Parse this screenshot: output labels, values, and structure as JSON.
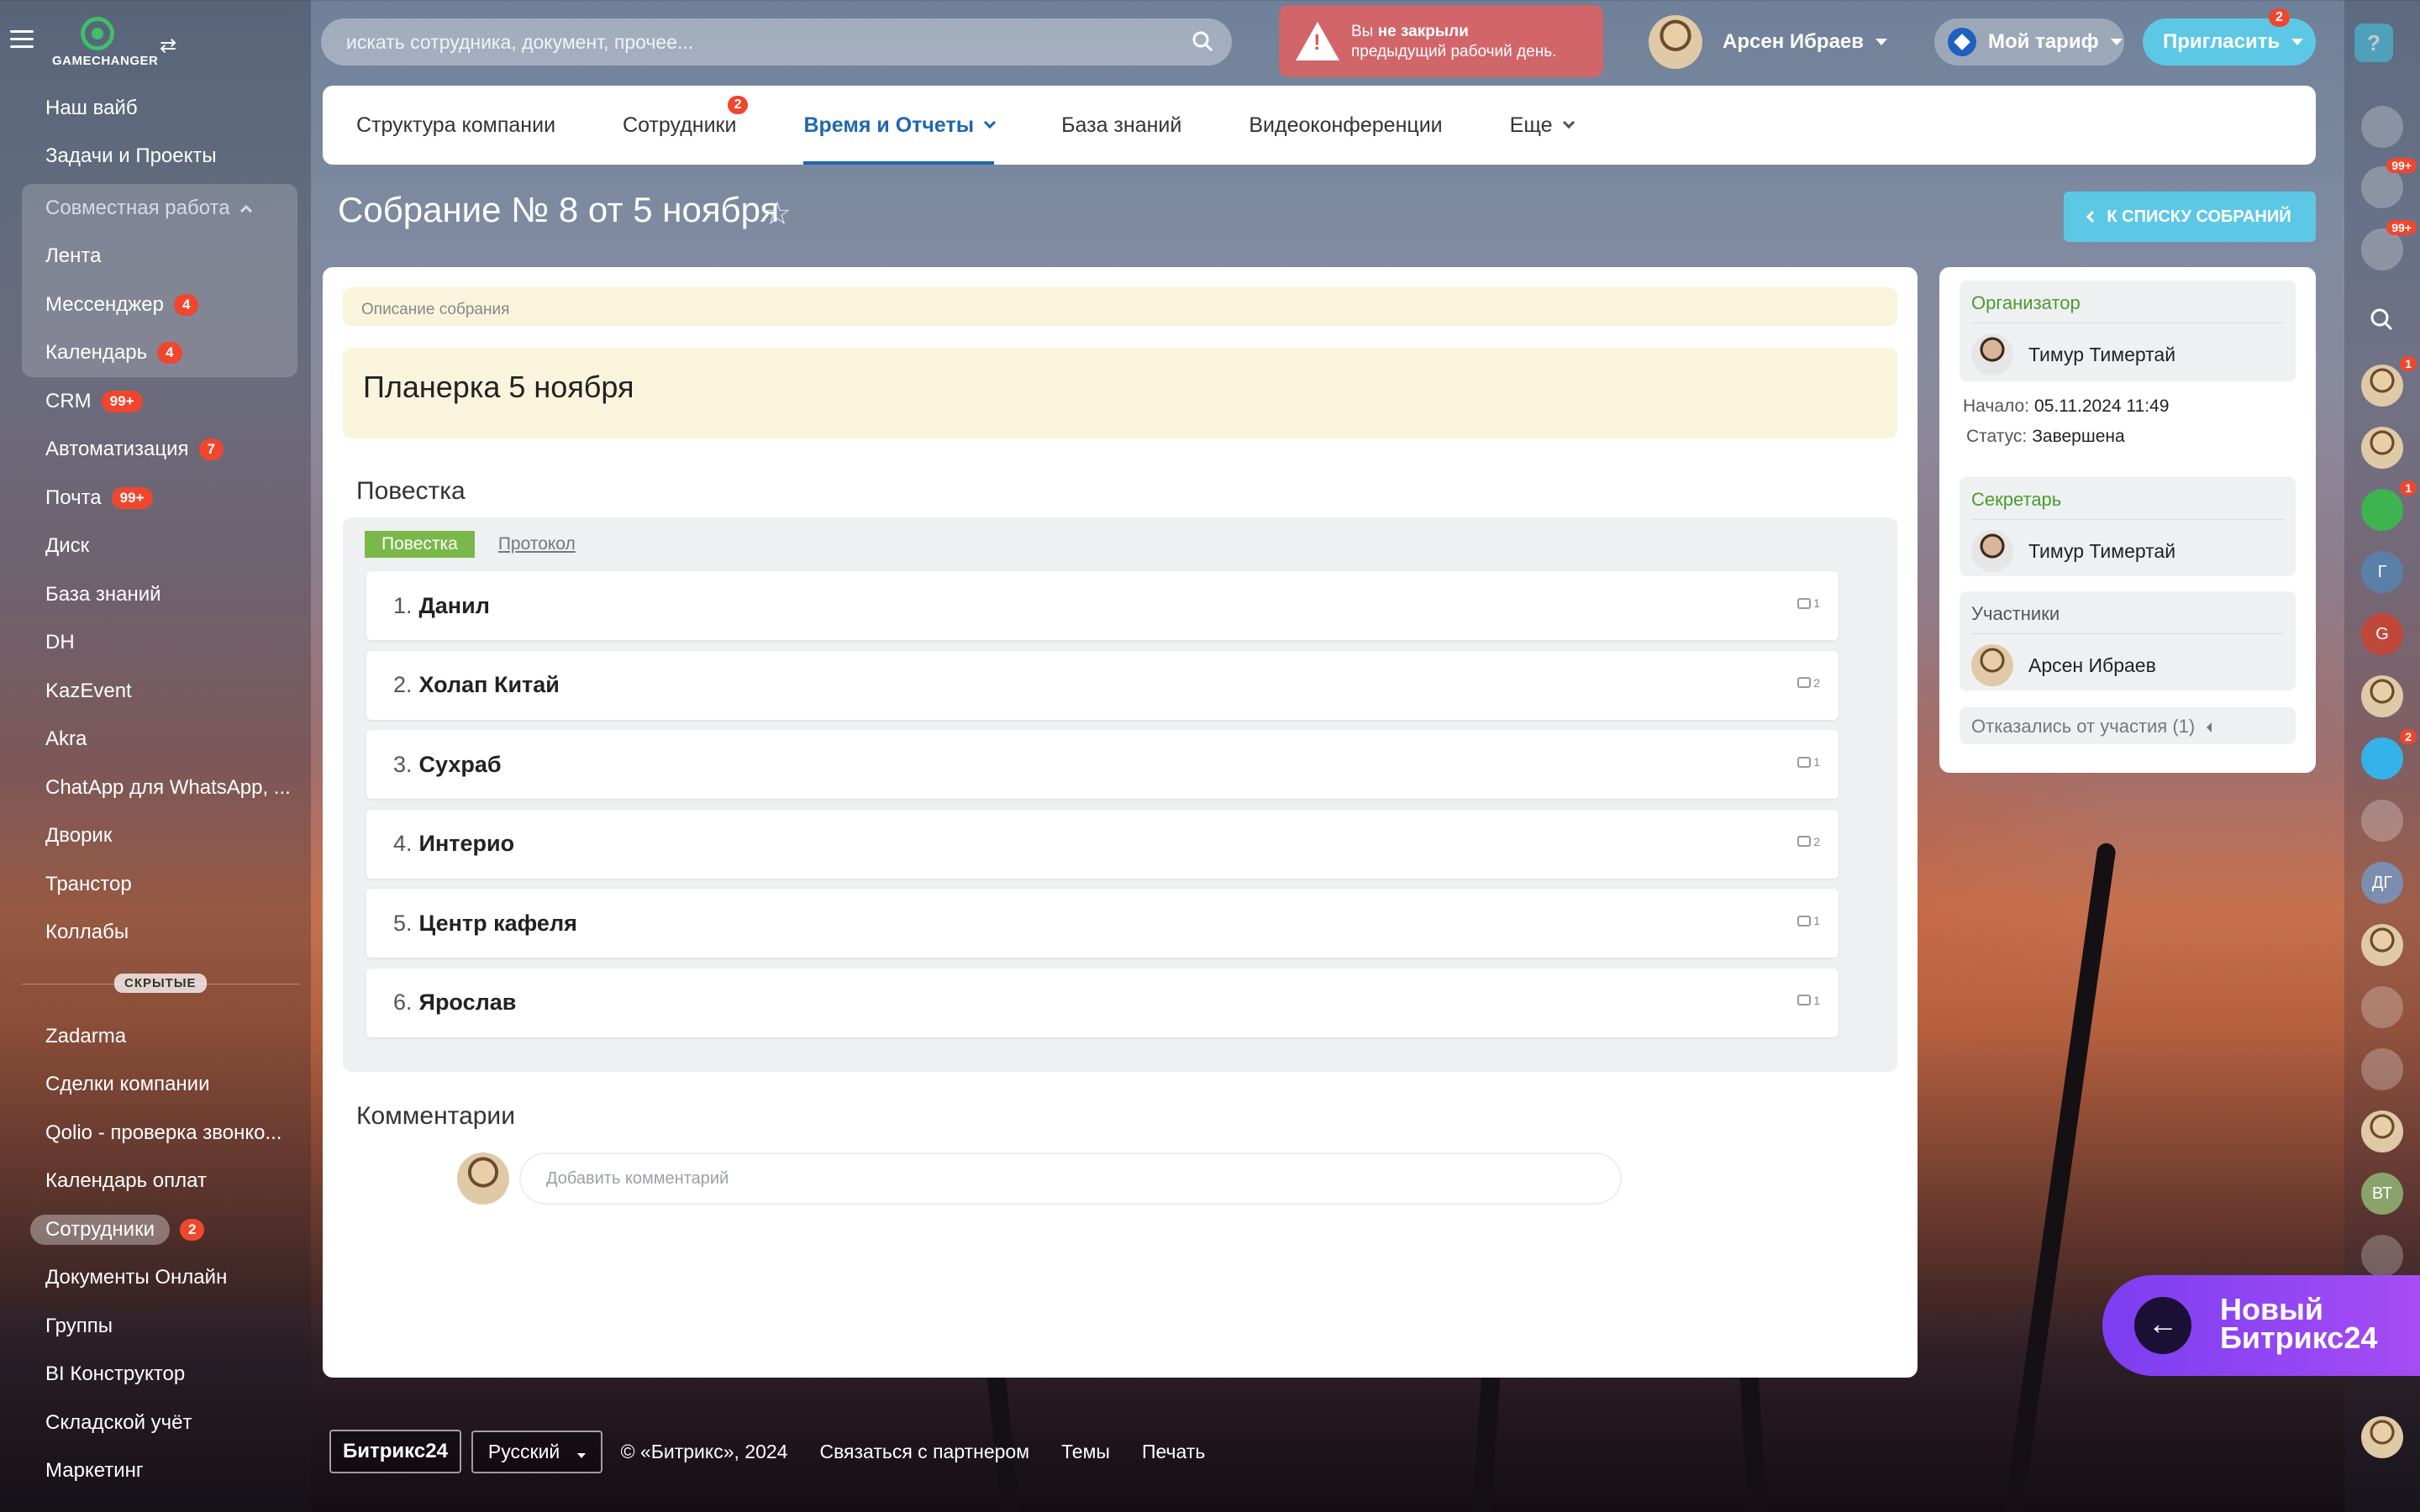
{
  "app": {
    "logo_text": "GAMECHANGER"
  },
  "search": {
    "placeholder": "искать сотрудника, документ, прочее..."
  },
  "warning": {
    "line1_prefix": "Вы ",
    "line1_bold": "не закрыли",
    "line2": "предыдущий рабочий день."
  },
  "user": {
    "name": "Арсен Ибраев"
  },
  "tariff": {
    "label": "Мой тариф"
  },
  "invite": {
    "label": "Пригласить",
    "badge": "2"
  },
  "help": {
    "label": "?"
  },
  "sidebar": {
    "items_top": [
      {
        "label": "Наш вайб"
      },
      {
        "label": "Задачи и Проекты"
      }
    ],
    "group": {
      "title": "Совместная работа",
      "items": [
        {
          "label": "Лента",
          "badge": ""
        },
        {
          "label": "Мессенджер",
          "badge": "4"
        },
        {
          "label": "Календарь",
          "badge": "4"
        }
      ]
    },
    "items_main": [
      {
        "label": "CRM",
        "badge": "99+"
      },
      {
        "label": "Автоматизация",
        "badge": "7"
      },
      {
        "label": "Почта",
        "badge": "99+"
      },
      {
        "label": "Диск",
        "badge": ""
      },
      {
        "label": "База знаний",
        "badge": ""
      },
      {
        "label": "DH",
        "badge": ""
      },
      {
        "label": "KazEvent",
        "badge": ""
      },
      {
        "label": "Akra",
        "badge": ""
      },
      {
        "label": "ChatApp для WhatsApp, ...",
        "badge": ""
      },
      {
        "label": "Дворик",
        "badge": ""
      },
      {
        "label": "Транстор",
        "badge": ""
      },
      {
        "label": "Коллабы",
        "badge": ""
      }
    ],
    "hidden_label": "СКРЫТЫЕ",
    "items_hidden": [
      {
        "label": "Zadarma",
        "badge": ""
      },
      {
        "label": "Сделки компании",
        "badge": ""
      },
      {
        "label": "Qolio - проверка звонко...",
        "badge": ""
      },
      {
        "label": "Календарь оплат",
        "badge": ""
      },
      {
        "label": "Сотрудники",
        "badge": "2"
      },
      {
        "label": "Документы Онлайн",
        "badge": ""
      },
      {
        "label": "Группы",
        "badge": ""
      },
      {
        "label": "BI Конструктор",
        "badge": ""
      },
      {
        "label": "Складской учёт",
        "badge": ""
      },
      {
        "label": "Маркетинг",
        "badge": ""
      }
    ]
  },
  "tabs": [
    {
      "label": "Структура компании",
      "badge": ""
    },
    {
      "label": "Сотрудники",
      "badge": "2"
    },
    {
      "label": "Время и Отчеты",
      "badge": ""
    },
    {
      "label": "База знаний",
      "badge": ""
    },
    {
      "label": "Видеоконференции",
      "badge": ""
    },
    {
      "label": "Еще",
      "badge": ""
    }
  ],
  "page": {
    "title": "Собрание № 8 от 5 ноября",
    "back_button": "К СПИСКУ СОБРАНИЙ"
  },
  "meeting": {
    "description_label": "Описание собрания",
    "description": "Планерка 5 ноября",
    "agenda_heading": "Повестка",
    "agenda_tabs": [
      "Повестка",
      "Протокол"
    ],
    "agenda": [
      {
        "num": "1.",
        "name": "Данил",
        "comments": "1"
      },
      {
        "num": "2.",
        "name": "Холап Китай",
        "comments": "2"
      },
      {
        "num": "3.",
        "name": "Сухраб",
        "comments": "1"
      },
      {
        "num": "4.",
        "name": "Интерио",
        "comments": "2"
      },
      {
        "num": "5.",
        "name": "Центр кафеля",
        "comments": "1"
      },
      {
        "num": "6.",
        "name": "Ярослав",
        "comments": "1"
      }
    ],
    "comments_heading": "Комментарии",
    "comment_placeholder": "Добавить комментарий"
  },
  "details": {
    "organizer_label": "Организатор",
    "organizer": "Тимур Тимертай",
    "start_label": "Начало:",
    "start_value": "05.11.2024 11:49",
    "status_label": "Статус:",
    "status_value": "Завершена",
    "secretary_label": "Секретарь",
    "secretary": "Тимур Тимертай",
    "participants_label": "Участники",
    "participant": "Арсен Ибраев",
    "refused": "Отказались от участия (1)"
  },
  "rail": {
    "badges": [
      "99+",
      "99+",
      "1",
      "1",
      "2"
    ],
    "initials": [
      "Г",
      "G",
      "ДГ",
      "ВТ"
    ]
  },
  "promo": {
    "line1": "Новый",
    "line2": "Битрикс24"
  },
  "footer": {
    "logo": "Битрикс24",
    "language": "Русский",
    "copyright": "© «Битрикс», 2024",
    "partner": "Связаться с партнером",
    "themes": "Темы",
    "print": "Печать"
  },
  "colors": {
    "accent_blue": "#2067b0",
    "button_cyan": "#5cc8e6",
    "badge_red": "#f0462e",
    "green": "#7ab84a"
  }
}
